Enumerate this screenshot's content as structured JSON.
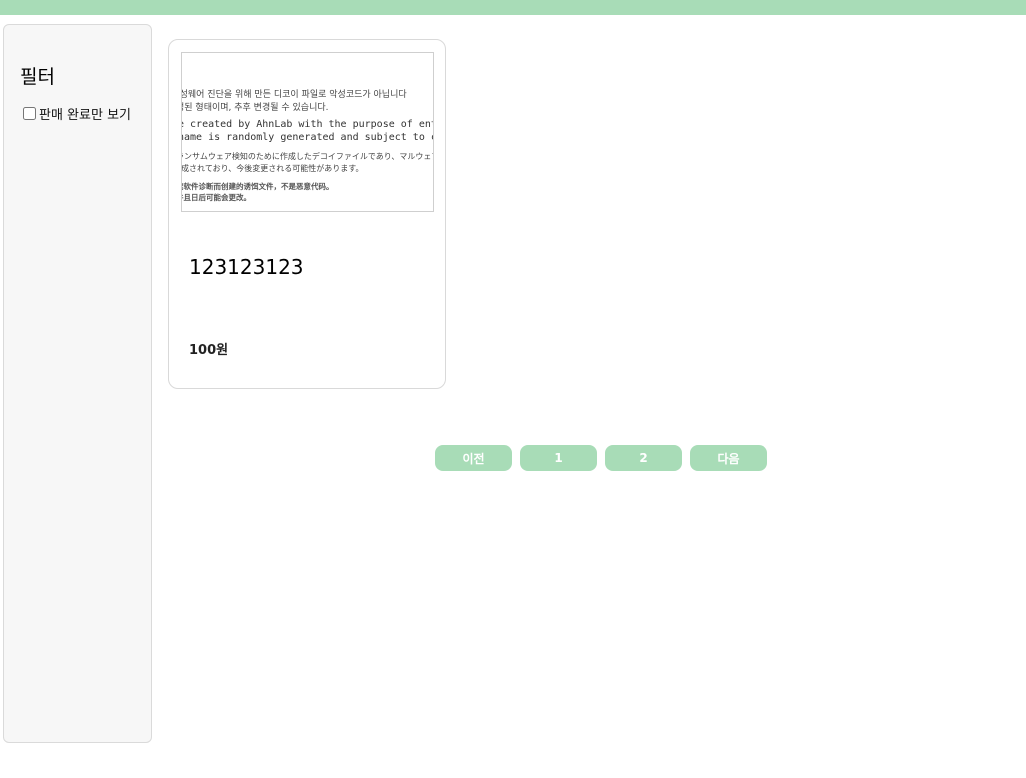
{
  "sidebar": {
    "title": "필터",
    "filter_sold_out_label": "판매 완료만 보기",
    "filter_sold_out_checked": false
  },
  "products": [
    {
      "thumbnail_lines": [
        "!성웨어 진단을 위해 만든 디코이 파일로 악성코드가 아닙니다",
        "성된 형태이며, 추후 변경될 수 있습니다.",
        "e created by AhnLab with the purpose of enticing ra",
        "name is randomly generated and subject to change",
        "ランサムウェア検知のために作成したデコイファイルであり、マルウェア",
        "E成されており、今後変更される可能性があります。",
        "索软件诊断而创建的诱饵文件，不是恶意代码。",
        "件且日后可能会更改。"
      ],
      "name": "123123123",
      "price": "100원"
    }
  ],
  "pagination": {
    "prev_label": "이전",
    "pages": [
      "1",
      "2"
    ],
    "next_label": "다음"
  },
  "colors": {
    "accent": "#a8dcb7",
    "sidebar_bg": "#f7f7f7"
  }
}
